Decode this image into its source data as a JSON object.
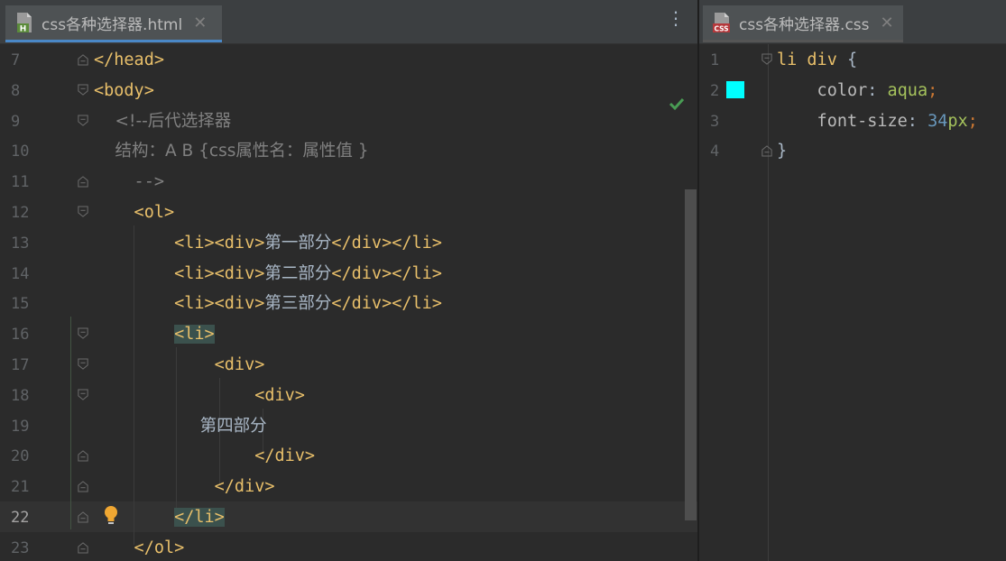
{
  "left_tab": {
    "label": "css各种选择器.html",
    "icon": "html-file-icon",
    "close": "✕"
  },
  "right_tab": {
    "label": "css各种选择器.css",
    "icon": "css-file-icon",
    "close": "✕"
  },
  "more_menu": "⋮",
  "html_lines": [
    {
      "n": "7",
      "parts": [
        [
          "tag",
          "</head>"
        ]
      ]
    },
    {
      "n": "8",
      "parts": [
        [
          "tag",
          "<body>"
        ]
      ]
    },
    {
      "n": "9",
      "parts": [
        [
          "cmt",
          "    <!--后代选择器"
        ]
      ]
    },
    {
      "n": "10",
      "parts": [
        [
          "cmt",
          "    结构：A B {css属性名：属性值 }"
        ]
      ]
    },
    {
      "n": "11",
      "parts": [
        [
          "cmt",
          "    -->"
        ]
      ]
    },
    {
      "n": "12",
      "parts": [
        [
          "tag",
          "    <ol>"
        ]
      ]
    },
    {
      "n": "13",
      "parts": [
        [
          "tag",
          "        <li><div>"
        ],
        [
          "txt",
          "第一部分"
        ],
        [
          "tag",
          "</div></li>"
        ]
      ]
    },
    {
      "n": "14",
      "parts": [
        [
          "tag",
          "        <li><div>"
        ],
        [
          "txt",
          "第二部分"
        ],
        [
          "tag",
          "</div></li>"
        ]
      ]
    },
    {
      "n": "15",
      "parts": [
        [
          "tag",
          "        <li><div>"
        ],
        [
          "txt",
          "第三部分"
        ],
        [
          "tag",
          "</div></li>"
        ]
      ]
    },
    {
      "n": "16",
      "parts": [
        [
          "tag",
          "        "
        ],
        [
          "taghl",
          "<li>"
        ]
      ]
    },
    {
      "n": "17",
      "parts": [
        [
          "tag",
          "            <div>"
        ]
      ]
    },
    {
      "n": "18",
      "parts": [
        [
          "tag",
          "                <div>"
        ]
      ]
    },
    {
      "n": "19",
      "parts": [
        [
          "txt",
          "                    第四部分"
        ]
      ]
    },
    {
      "n": "20",
      "parts": [
        [
          "tag",
          "                </div>"
        ]
      ]
    },
    {
      "n": "21",
      "parts": [
        [
          "tag",
          "            </div>"
        ]
      ]
    },
    {
      "n": "22",
      "parts": [
        [
          "tag",
          "        "
        ],
        [
          "taghl",
          "</li>"
        ]
      ]
    },
    {
      "n": "23",
      "parts": [
        [
          "tag",
          "    </ol>"
        ]
      ]
    }
  ],
  "css_lines": [
    {
      "n": "1",
      "parts": [
        [
          "css-sel",
          "li div "
        ],
        [
          "txt",
          "{"
        ]
      ]
    },
    {
      "n": "2",
      "parts": [
        [
          "css-prop",
          "    color"
        ],
        [
          "txt",
          ": "
        ],
        [
          "css-val",
          "aqua"
        ],
        [
          "css-punc",
          ";"
        ]
      ]
    },
    {
      "n": "3",
      "parts": [
        [
          "css-prop",
          "    font-size"
        ],
        [
          "txt",
          ": "
        ],
        [
          "css-num",
          "34"
        ],
        [
          "css-unit",
          "px"
        ],
        [
          "css-punc",
          ";"
        ]
      ]
    },
    {
      "n": "4",
      "parts": [
        [
          "txt",
          "}"
        ]
      ]
    }
  ],
  "colors": {
    "swatch": "#00ffff",
    "tag": "#e8bf6a",
    "comment": "#808080",
    "text": "#a9b7c6"
  },
  "current_line": "22",
  "status_icons": {
    "inspection": "check-icon",
    "intention": "lightbulb-icon"
  }
}
